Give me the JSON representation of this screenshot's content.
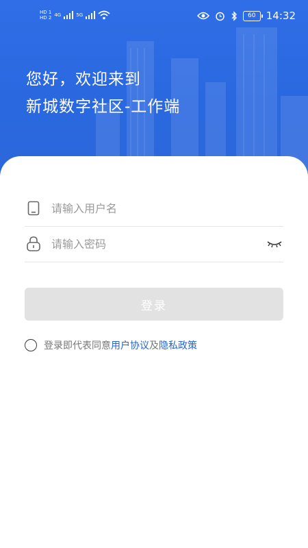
{
  "status_bar": {
    "network_left": [
      "HD 1",
      "HD 2"
    ],
    "signal_labels": [
      "4G",
      "5G"
    ],
    "battery": "60",
    "time": "14:32"
  },
  "header": {
    "greeting_line1": "您好，欢迎来到",
    "greeting_line2": "新城数字社区-工作端"
  },
  "form": {
    "username_placeholder": "请输入用户名",
    "password_placeholder": "请输入密码",
    "login_label": "登录"
  },
  "agreement": {
    "prefix": "登录即代表同意",
    "user_agreement": "用户协议",
    "and": "及",
    "privacy_policy": "隐私政策"
  },
  "colors": {
    "hero": "#2f6ee6",
    "link": "#2366d1",
    "button_disabled": "#e2e2e2"
  }
}
